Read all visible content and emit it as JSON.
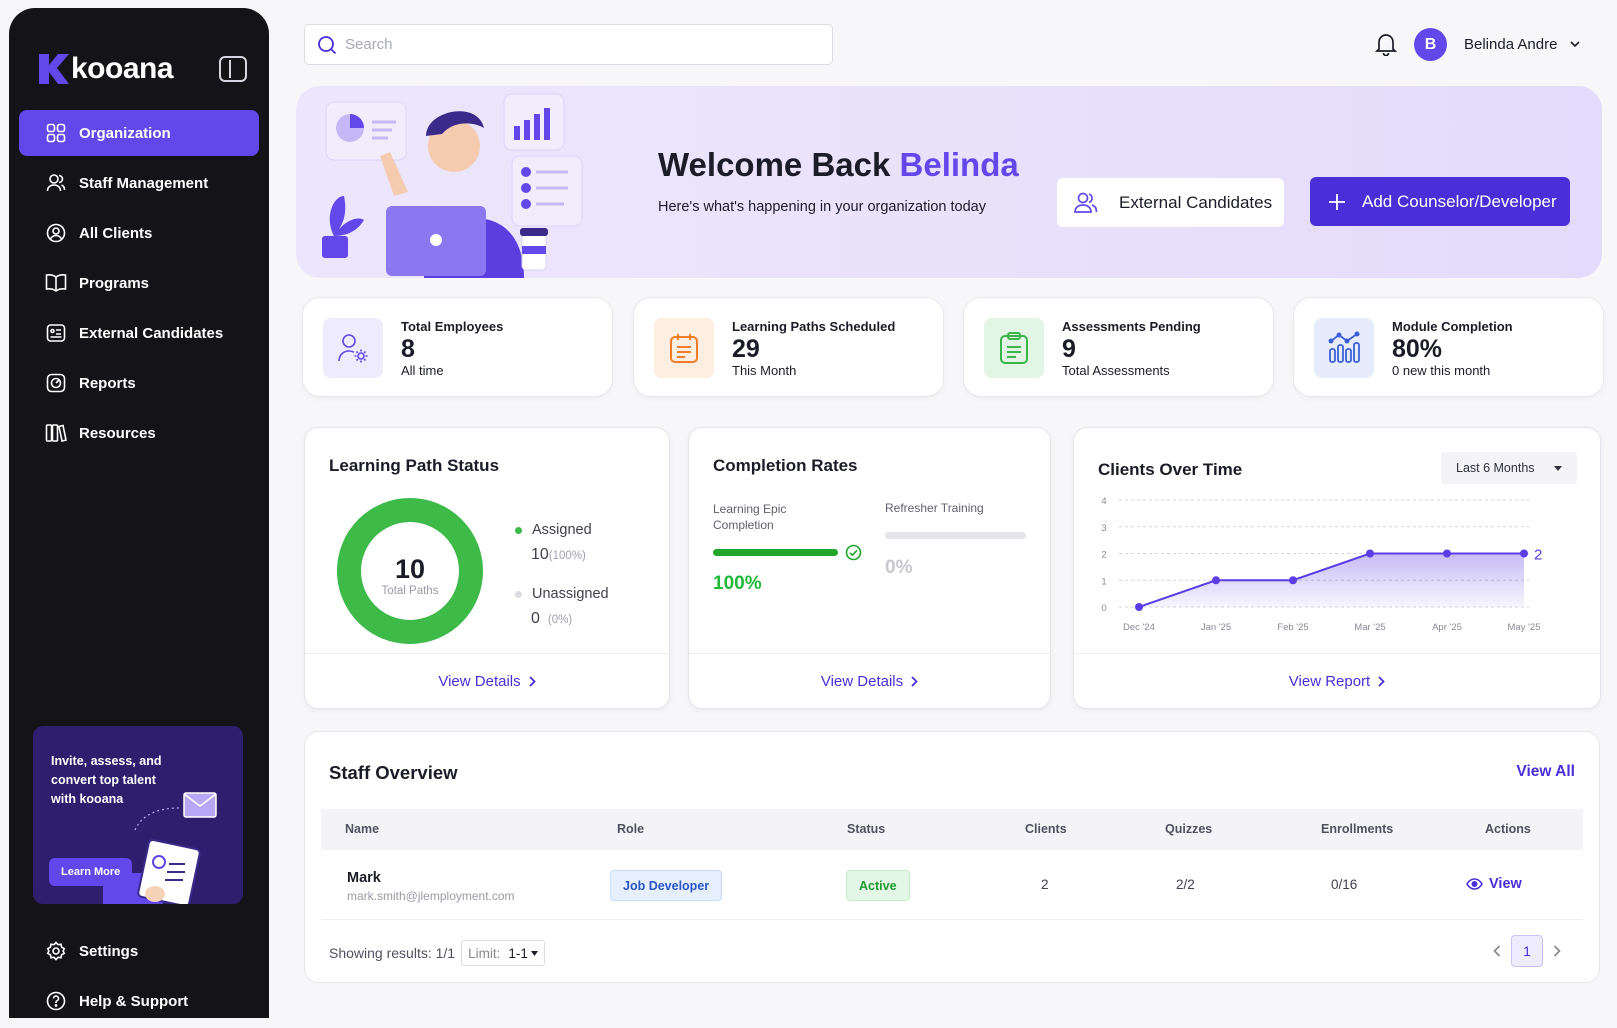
{
  "app": {
    "brand": "kooana"
  },
  "sidebar": {
    "items": [
      {
        "label": "Organization",
        "active": true,
        "icon": "grid-icon"
      },
      {
        "label": "Staff Management",
        "icon": "users-icon"
      },
      {
        "label": "All Clients",
        "icon": "user-circle-icon"
      },
      {
        "label": "Programs",
        "icon": "book-icon"
      },
      {
        "label": "External Candidates",
        "icon": "id-card-icon"
      },
      {
        "label": "Reports",
        "icon": "report-icon"
      },
      {
        "label": "Resources",
        "icon": "library-icon"
      }
    ],
    "promo": {
      "text": "Invite, assess, and convert top talent with kooana",
      "button": "Learn More"
    },
    "bottom": [
      {
        "label": "Settings",
        "icon": "gear-icon"
      },
      {
        "label": "Help  & Support",
        "icon": "help-icon"
      }
    ]
  },
  "header": {
    "search_placeholder": "Search",
    "user_initial": "B",
    "user_name": "Belinda Andre"
  },
  "hero": {
    "title": "Welcome Back ",
    "title_name": "Belinda",
    "subtitle": "Here's what's happening in your organization today",
    "btn_external": "External Candidates",
    "btn_add": "Add Counselor/Developer"
  },
  "stats": [
    {
      "label": "Total Employees",
      "value": "8",
      "sub": "All time",
      "color": "#6247ea"
    },
    {
      "label": "Learning Paths Scheduled",
      "value": "29",
      "sub": "This Month",
      "color": "#f07c2a"
    },
    {
      "label": "Assessments Pending",
      "value": "9",
      "sub": "Total Assessments",
      "color": "#3bb54a"
    },
    {
      "label": "Module Completion",
      "value": "80%",
      "sub": "0 new this month",
      "color": "#3c5fd8"
    }
  ],
  "learning_path": {
    "title": "Learning Path Status",
    "total": "10",
    "total_label": "Total Paths",
    "assigned_label": "Assigned",
    "assigned_value": "10",
    "assigned_pct": "(100%)",
    "unassigned_label": "Unassigned",
    "unassigned_value": "0",
    "unassigned_pct": "(0%)",
    "assigned_fraction": 1.0,
    "footer": "View Details"
  },
  "completion": {
    "title": "Completion Rates",
    "epic_label": "Learning Epic Completion",
    "epic_value": "100%",
    "epic_fraction": 1.0,
    "refresher_label": "Refresher Training",
    "refresher_value": "0%",
    "refresher_fraction": 0.0,
    "footer": "View Details"
  },
  "clients_chart": {
    "title": "Clients Over Time",
    "range_select": "Last 6 Months",
    "footer": "View Report",
    "end_label": "2"
  },
  "chart_data": {
    "type": "area",
    "categories": [
      "Dec '24",
      "Jan '25",
      "Feb '25",
      "Mar '25",
      "Apr '25",
      "May '25"
    ],
    "values": [
      0,
      1,
      1,
      2,
      2,
      2
    ],
    "y_ticks": [
      "0",
      "1",
      "2",
      "3",
      "4"
    ],
    "ylim": [
      0,
      4
    ],
    "grid": true,
    "color": "#5b3de6"
  },
  "staff": {
    "title": "Staff Overview",
    "view_all": "View All",
    "columns": [
      "Name",
      "Role",
      "Status",
      "Clients",
      "Quizzes",
      "Enrollments",
      "Actions"
    ],
    "rows": [
      {
        "name": "Mark",
        "email": "mark.smith@jlemployment.com",
        "role": "Job Developer",
        "status": "Active",
        "clients": "2",
        "quizzes": "2/2",
        "enrollments": "0/16",
        "action": "View"
      }
    ],
    "showing": "Showing results: 1/1",
    "limit_label": "Limit:",
    "limit_value": "1-1",
    "page": "1"
  }
}
